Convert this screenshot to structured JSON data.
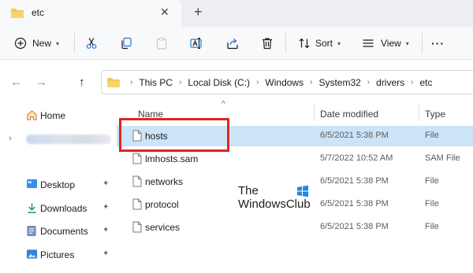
{
  "tab": {
    "title": "etc",
    "close": "✕",
    "new_tab": "+"
  },
  "toolbar": {
    "new_label": "New",
    "sort_label": "Sort",
    "view_label": "View",
    "more_label": "···"
  },
  "address": {
    "crumbs": [
      "This PC",
      "Local Disk (C:)",
      "Windows",
      "System32",
      "drivers",
      "etc"
    ],
    "separator": "›"
  },
  "nav": {
    "back": "←",
    "forward": "→",
    "up": "↑",
    "home_label": "Home",
    "items": [
      {
        "label": "Desktop"
      },
      {
        "label": "Downloads"
      },
      {
        "label": "Documents"
      },
      {
        "label": "Pictures"
      }
    ],
    "pin": "✦"
  },
  "columns": {
    "name": "Name",
    "date": "Date modified",
    "type": "Type"
  },
  "files": [
    {
      "name": "hosts",
      "date": "6/5/2021 5:38 PM",
      "type": "File"
    },
    {
      "name": "lmhosts.sam",
      "date": "5/7/2022 10:52 AM",
      "type": "SAM File"
    },
    {
      "name": "networks",
      "date": "6/5/2021 5:38 PM",
      "type": "File"
    },
    {
      "name": "protocol",
      "date": "6/5/2021 5:38 PM",
      "type": "File"
    },
    {
      "name": "services",
      "date": "6/5/2021 5:38 PM",
      "type": "File"
    }
  ],
  "watermark": {
    "line1": "The",
    "line2": "WindowsClub"
  },
  "colors": {
    "accent": "#0067c0",
    "selected_row": "#cce4f7",
    "highlight": "#e02424",
    "folder": "#f2c94c"
  }
}
